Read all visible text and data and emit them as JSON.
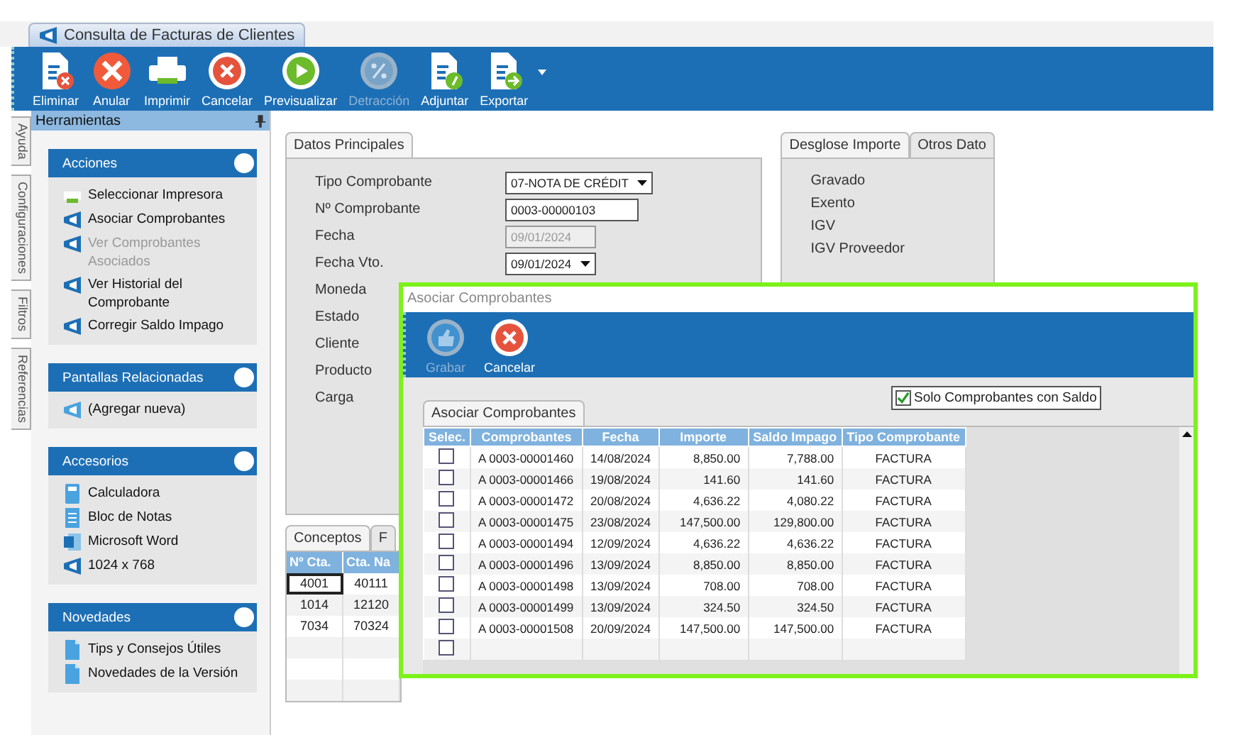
{
  "document_tab": {
    "title": "Consulta de Facturas de Clientes"
  },
  "toolbar": [
    {
      "label": "Eliminar",
      "kind": "doc-delete",
      "disabled": false
    },
    {
      "label": "Anular",
      "kind": "x-filled",
      "disabled": false
    },
    {
      "label": "Imprimir",
      "kind": "printer",
      "disabled": false
    },
    {
      "label": "Cancelar",
      "kind": "x-ring",
      "disabled": false
    },
    {
      "label": "Previsualizar",
      "kind": "play",
      "disabled": false
    },
    {
      "label": "Detracción",
      "kind": "percent",
      "disabled": true
    },
    {
      "label": "Adjuntar",
      "kind": "doc-attach",
      "disabled": false
    },
    {
      "label": "Exportar",
      "kind": "doc-export",
      "disabled": false
    }
  ],
  "side_tabs": [
    {
      "label": "Ayuda"
    },
    {
      "label": "Configuraciones"
    },
    {
      "label": "Filtros"
    },
    {
      "label": "Referencias"
    }
  ],
  "tools_panel": {
    "title": "Herramientas",
    "sections": [
      {
        "title": "Acciones",
        "items": [
          {
            "label": "Seleccionar Impresora",
            "kind": "printer",
            "disabled": false
          },
          {
            "label": "Asociar Comprobantes",
            "kind": "shield",
            "disabled": false
          },
          {
            "label": "Ver Comprobantes Asociados",
            "kind": "shield",
            "disabled": true
          },
          {
            "label": "Ver Historial del Comprobante",
            "kind": "shield",
            "disabled": false
          },
          {
            "label": "Corregir Saldo Impago",
            "kind": "shield",
            "disabled": false
          }
        ]
      },
      {
        "title": "Pantallas Relacionadas",
        "items": [
          {
            "label": "(Agregar nueva)",
            "kind": "shield-light",
            "disabled": false
          }
        ]
      },
      {
        "title": "Accesorios",
        "items": [
          {
            "label": "Calculadora",
            "kind": "calculator",
            "disabled": false
          },
          {
            "label": "Bloc de Notas",
            "kind": "notes",
            "disabled": false
          },
          {
            "label": "Microsoft Word",
            "kind": "word",
            "disabled": false
          },
          {
            "label": "1024 x 768",
            "kind": "shield",
            "disabled": false
          }
        ]
      },
      {
        "title": "Novedades",
        "items": [
          {
            "label": "Tips y Consejos Útiles",
            "kind": "doc",
            "disabled": false
          },
          {
            "label": "Novedades de la Versión",
            "kind": "doc",
            "disabled": false
          }
        ]
      }
    ]
  },
  "main_tab": {
    "label": "Datos Principales"
  },
  "fields": [
    {
      "label": "Tipo Comprobante",
      "kind": "select",
      "value": "07-NOTA DE CRÉDIT",
      "disabled": false
    },
    {
      "label": "Nº Comprobante",
      "kind": "text",
      "value": "0003-00000103",
      "disabled": false
    },
    {
      "label": "Fecha",
      "kind": "text",
      "value": "09/01/2024",
      "disabled": true
    },
    {
      "label": "Fecha Vto.",
      "kind": "select",
      "value": "09/01/2024",
      "disabled": false
    },
    {
      "label": "Moneda",
      "kind": "label"
    },
    {
      "label": "Estado",
      "kind": "label"
    },
    {
      "label": "Cliente",
      "kind": "label"
    },
    {
      "label": "Producto",
      "kind": "label"
    },
    {
      "label": "Carga",
      "kind": "label"
    }
  ],
  "right_tabs": [
    {
      "label": "Desglose Importe",
      "selected": true
    },
    {
      "label": "Otros Dato",
      "selected": false
    }
  ],
  "breakdown": [
    "Gravado",
    "Exento",
    "IGV",
    "IGV Proveedor"
  ],
  "bottom_tabs": [
    {
      "label": "Conceptos",
      "selected": true
    },
    {
      "label": "F",
      "selected": false
    }
  ],
  "concepts": {
    "columns": [
      "Nº Cta.",
      "Cta. Na"
    ],
    "rows": [
      [
        "4001",
        "40111"
      ],
      [
        "1014",
        "12120"
      ],
      [
        "7034",
        "70324"
      ]
    ]
  },
  "dialog": {
    "title": "Asociar Comprobantes",
    "toolbar": [
      {
        "label": "Grabar",
        "kind": "thumb",
        "disabled": true
      },
      {
        "label": "Cancelar",
        "kind": "x-ring",
        "disabled": false
      }
    ],
    "filter": {
      "label": "Solo Comprobantes con Saldo",
      "checked": true
    },
    "tab": {
      "label": "Asociar Comprobantes"
    },
    "select_column": "Selec.",
    "columns": [
      "Comprobantes",
      "Fecha",
      "Importe",
      "Saldo Impago",
      "Tipo Comprobante"
    ],
    "rows": [
      {
        "checked": false,
        "cells": [
          "A 0003-00001460",
          "14/08/2024",
          "8,850.00",
          "7,788.00",
          "FACTURA"
        ]
      },
      {
        "checked": false,
        "cells": [
          "A 0003-00001466",
          "19/08/2024",
          "141.60",
          "141.60",
          "FACTURA"
        ]
      },
      {
        "checked": false,
        "cells": [
          "A 0003-00001472",
          "20/08/2024",
          "4,636.22",
          "4,080.22",
          "FACTURA"
        ]
      },
      {
        "checked": false,
        "cells": [
          "A 0003-00001475",
          "23/08/2024",
          "147,500.00",
          "129,800.00",
          "FACTURA"
        ]
      },
      {
        "checked": false,
        "cells": [
          "A 0003-00001494",
          "12/09/2024",
          "4,636.22",
          "4,636.22",
          "FACTURA"
        ]
      },
      {
        "checked": false,
        "cells": [
          "A 0003-00001496",
          "13/09/2024",
          "8,850.00",
          "8,850.00",
          "FACTURA"
        ]
      },
      {
        "checked": false,
        "cells": [
          "A 0003-00001498",
          "13/09/2024",
          "708.00",
          "708.00",
          "FACTURA"
        ]
      },
      {
        "checked": false,
        "cells": [
          "A 0003-00001499",
          "13/09/2024",
          "324.50",
          "324.50",
          "FACTURA"
        ]
      },
      {
        "checked": false,
        "cells": [
          "A 0003-00001508",
          "20/09/2024",
          "147,500.00",
          "147,500.00",
          "FACTURA"
        ]
      },
      {
        "checked": false,
        "cells": [
          "",
          "",
          "",
          "",
          ""
        ]
      }
    ]
  }
}
